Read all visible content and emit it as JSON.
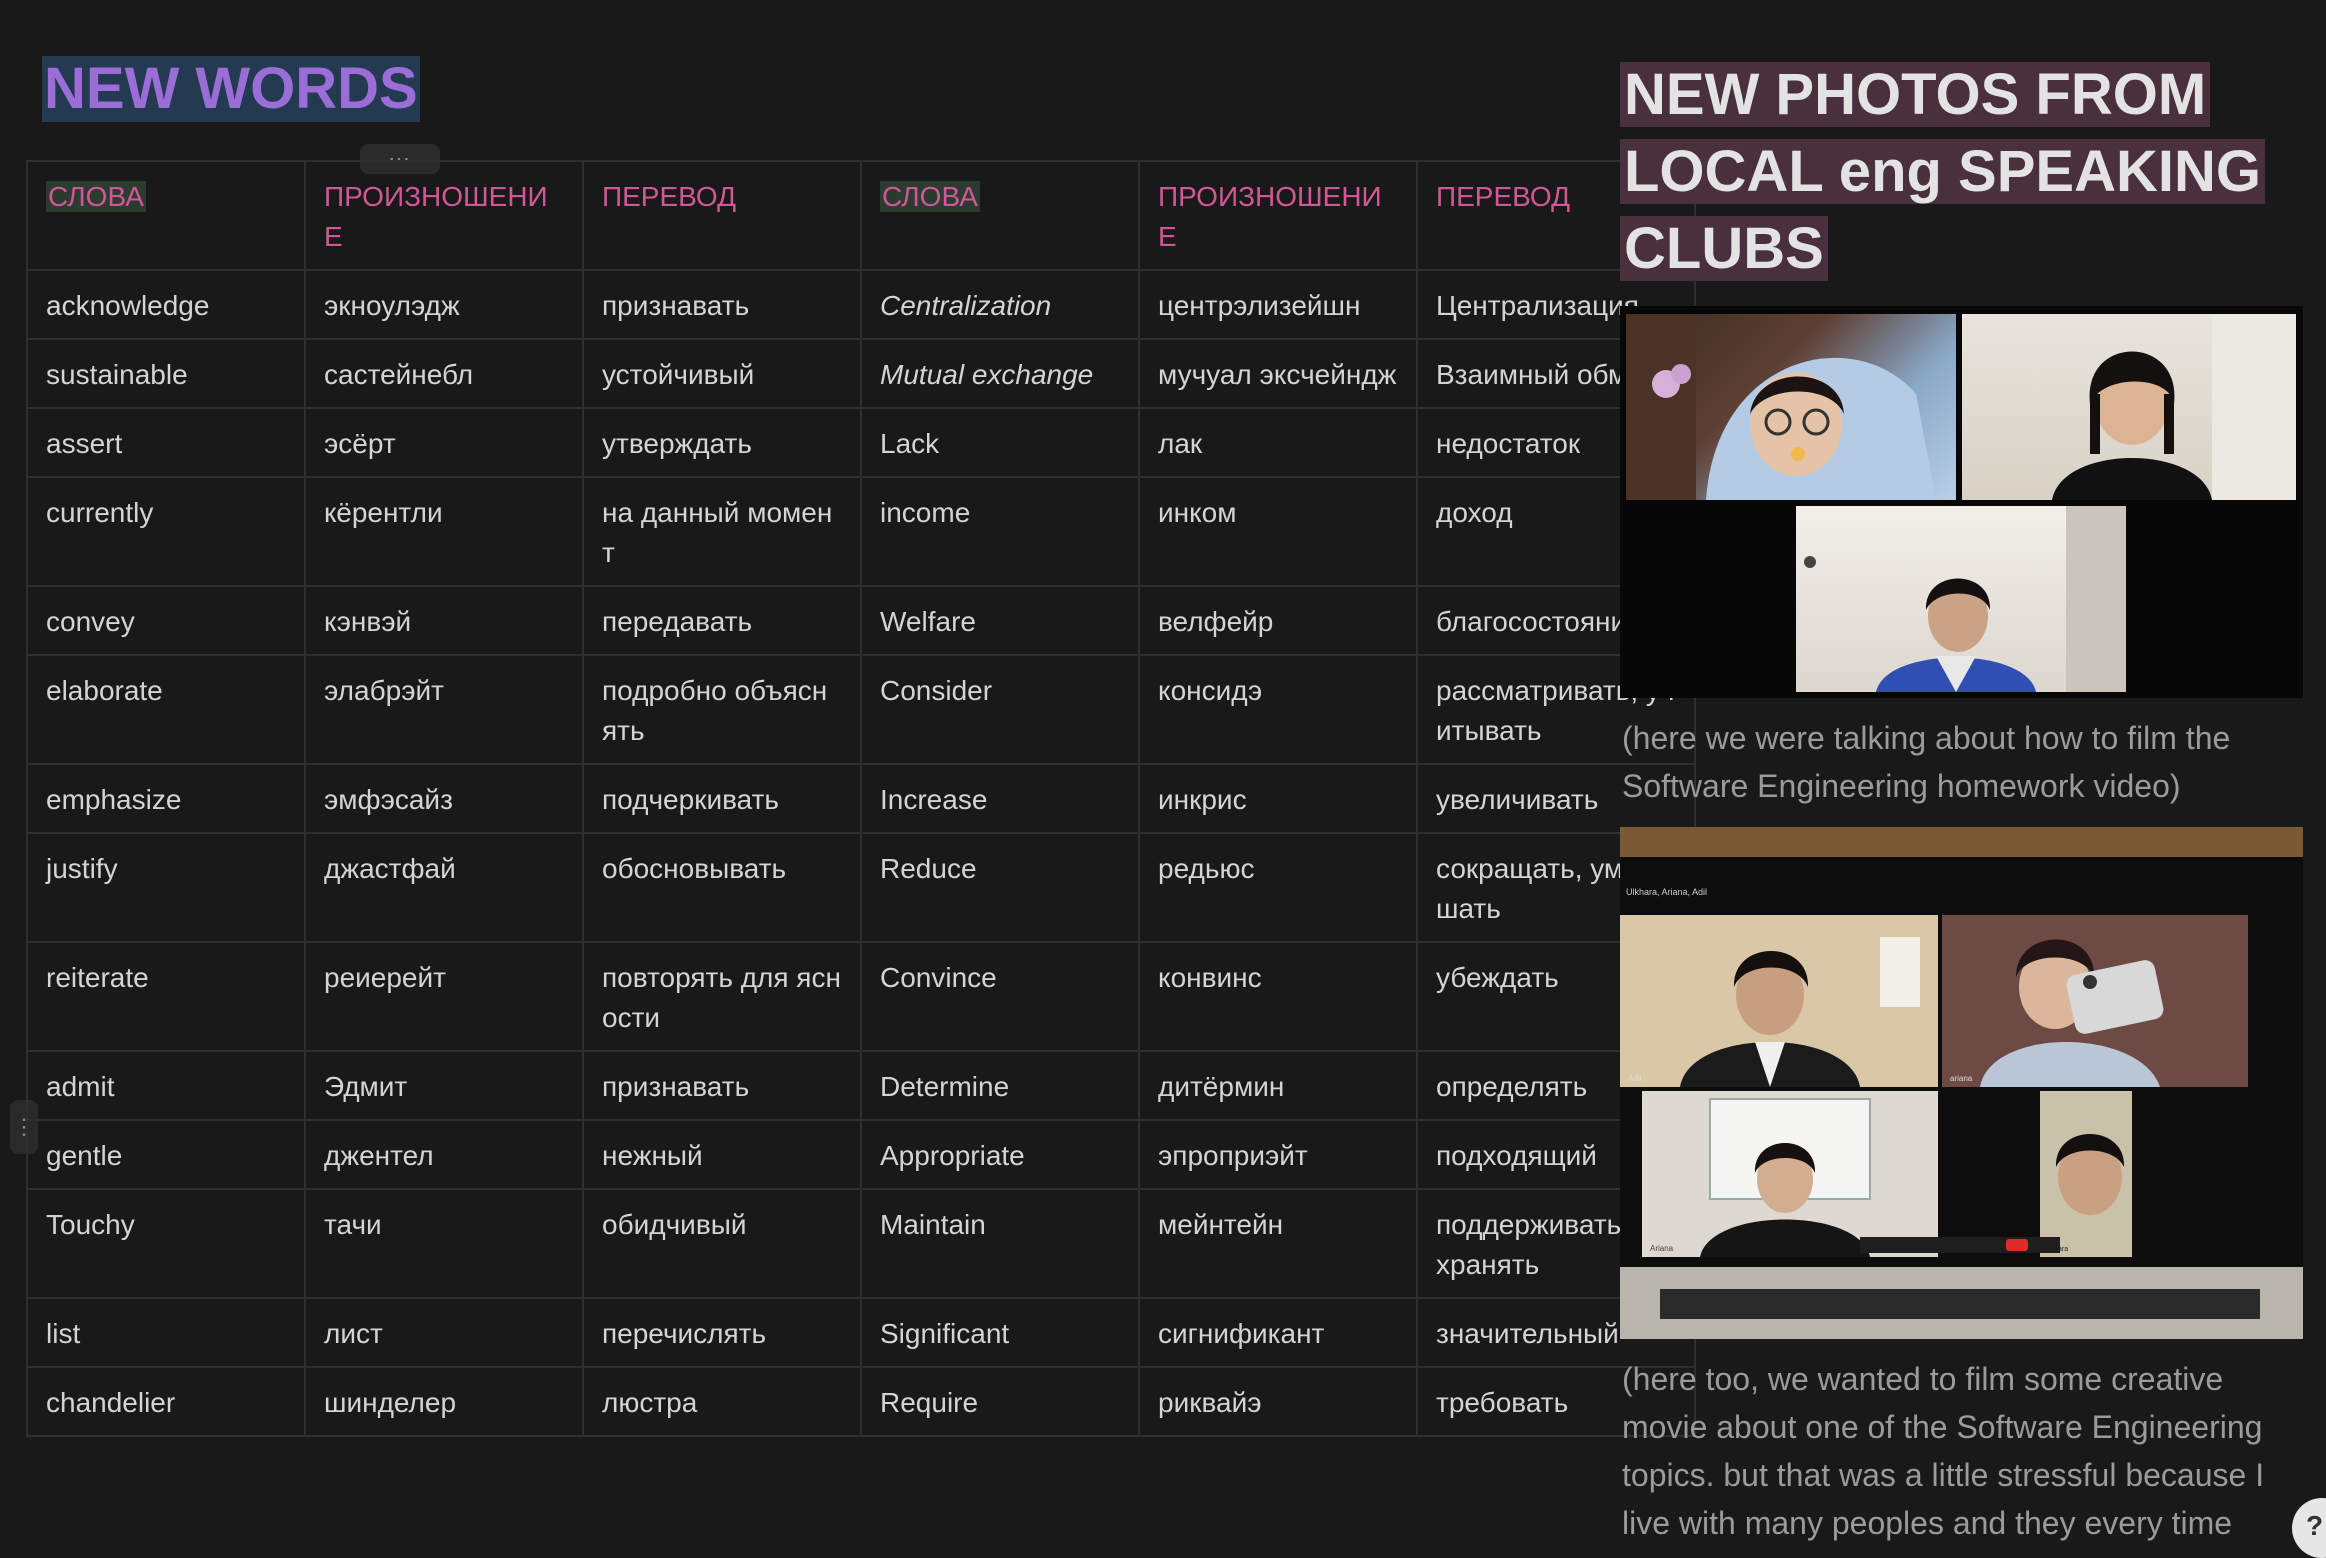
{
  "left": {
    "title": "NEW WORDS",
    "headers": [
      "СЛОВА",
      "ПРОИЗНОШЕНИЕ",
      "ПЕРЕВОД",
      "СЛОВА",
      "ПРОИЗНОШЕНИЕ",
      "ПЕРЕВОД"
    ],
    "rows": [
      [
        "acknowledge",
        " экноулэдж",
        "признавать",
        "Centralization",
        "центрэлизейшн",
        "Централизация"
      ],
      [
        "sustainable",
        "састейнебл",
        "устойчивый",
        "Mutual exchange",
        "мучуал эксчейндж",
        "Взаимный обмен"
      ],
      [
        "assert",
        "эсёрт",
        "утверждать",
        "Lack",
        "лак",
        "недостаток"
      ],
      [
        "currently",
        "кёрентли",
        "на данный момент",
        "income",
        "инком",
        "доход"
      ],
      [
        "convey",
        "кэнвэй",
        "передавать",
        "Welfare",
        "велфейр",
        "благосостояние"
      ],
      [
        "elaborate",
        "элабрэйт",
        "подробно объяснять",
        "Consider",
        "консидэ",
        "рассматривать, учитывать"
      ],
      [
        "emphasize",
        "эмфэсайз",
        "подчеркивать",
        "Increase",
        "инкрис",
        "увеличивать"
      ],
      [
        "justify",
        "джастфай",
        "обосновывать",
        "Reduce",
        "редьюс",
        " сокращать, уменьшать"
      ],
      [
        "reiterate",
        "реиерейт",
        "повторять для ясности",
        "Convince",
        "конвинс",
        "убеждать"
      ],
      [
        "admit",
        "Эдмит",
        "признавать",
        "Determine",
        "дитёрмин",
        "определять"
      ],
      [
        "gentle",
        "джентел",
        "нежный",
        "Appropriate",
        "эпроприэйт",
        "подходящий"
      ],
      [
        "Touchy",
        "тачи",
        "обидчивый",
        "Maintain",
        "мейнтейн",
        "поддерживать, сохранять"
      ],
      [
        "list",
        "лист",
        "перечислять",
        "Significant",
        "сигнификант",
        " значительный"
      ],
      [
        "chandelier",
        "шинделер",
        "люстра",
        "Require",
        "риквайэ",
        "требовать"
      ]
    ]
  },
  "right": {
    "title": "NEW PHOTOS FROM LOCAL eng SPEAKING CLUBS",
    "caption1": "(here we were talking about how to film the Software Engineering homework video)",
    "caption2": "(here too, we wanted to film some creative movie about one of the Software Engineering topics. but that was a little stressful because I live with many peoples and they every time"
  },
  "photo2": {
    "window_names": "Ulkhara, Ariana, Adil",
    "tile_labels": [
      "Adil",
      "ariana",
      "Ariana",
      "Ulkhara"
    ]
  },
  "colors": {
    "background": "#191919",
    "header_text": "#d15796",
    "title_purple": "#9a6dd7",
    "title_bg_blue": "#233a51",
    "title_bg_maroon": "#4a2f3d"
  }
}
